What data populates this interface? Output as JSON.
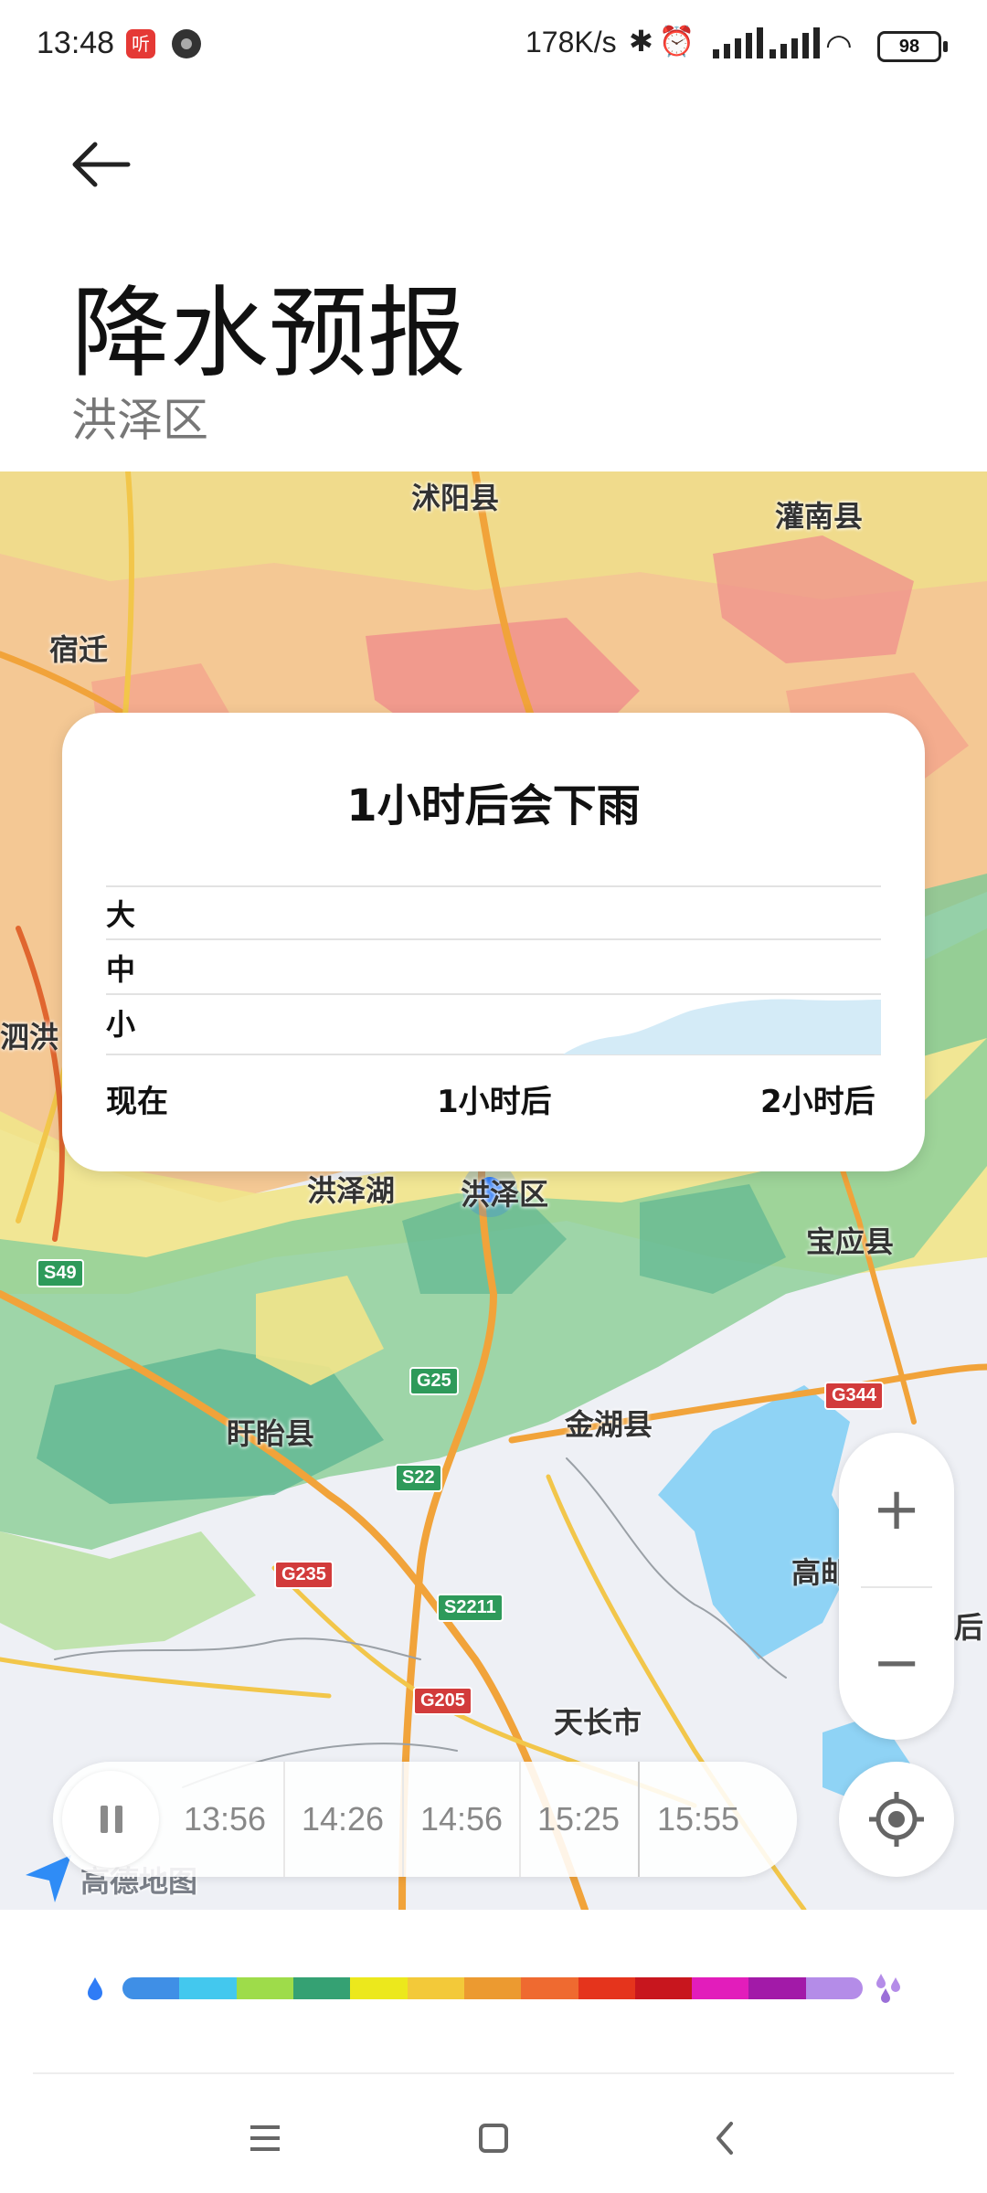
{
  "status_bar": {
    "time": "13:48",
    "app_badge": "听",
    "network_speed": "178K/s",
    "battery": "98"
  },
  "header": {
    "title": "降水预报",
    "subtitle": "洪泽区"
  },
  "forecast_card": {
    "headline": "1小时后会下雨",
    "levels": [
      "大",
      "中",
      "小"
    ],
    "time_ticks": [
      "现在",
      "1小时后",
      "2小时后"
    ]
  },
  "map": {
    "labels": {
      "shuyang": "沭阳县",
      "guannan": "灌南县",
      "suqian": "宿迁",
      "sihong": "泗洪",
      "hongzehu": "洪泽湖",
      "hongzequ": "洪泽区",
      "baoying": "宝应县",
      "xuyi": "盱眙县",
      "jinhu": "金湖县",
      "gaoyou": "高邮",
      "tianchang": "天长市",
      "edge": "后",
      "amap": "高德地图"
    },
    "roads": [
      "S49",
      "G25",
      "S22",
      "G344",
      "G235",
      "S2211",
      "G205"
    ]
  },
  "zoom": {
    "in": "+",
    "out": "−"
  },
  "timeline": {
    "times": [
      "13:56",
      "14:26",
      "14:56",
      "15:25",
      "15:55"
    ]
  },
  "legend_colors": [
    "#3f8fe6",
    "#43c8ee",
    "#9edc4a",
    "#35a173",
    "#ece81c",
    "#f3c939",
    "#ec9a30",
    "#ef6a30",
    "#e5341c",
    "#c8161e",
    "#e21dbb",
    "#a21aa8",
    "#b48ce8"
  ]
}
